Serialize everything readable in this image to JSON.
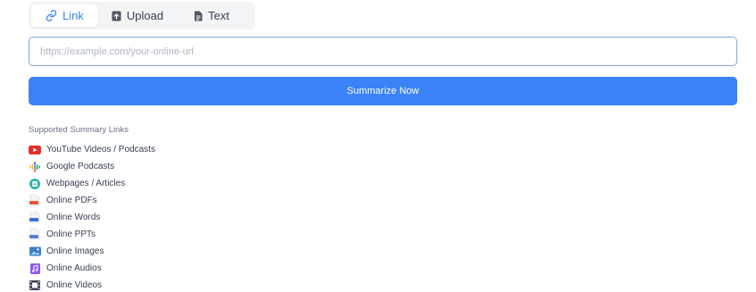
{
  "tabs": [
    {
      "label": "Link",
      "icon": "link-icon",
      "active": true
    },
    {
      "label": "Upload",
      "icon": "upload-icon",
      "active": false
    },
    {
      "label": "Text",
      "icon": "document-icon",
      "active": false
    }
  ],
  "input": {
    "placeholder": "https://example.com/your-online-url",
    "value": ""
  },
  "submit": {
    "label": "Summarize Now"
  },
  "supported": {
    "title": "Supported Summary Links",
    "items": [
      {
        "label": "YouTube Videos / Podcasts",
        "icon": "youtube-icon"
      },
      {
        "label": "Google Podcasts",
        "icon": "google-podcasts-icon"
      },
      {
        "label": "Webpages / Articles",
        "icon": "webpage-icon"
      },
      {
        "label": "Online PDFs",
        "icon": "pdf-icon"
      },
      {
        "label": "Online Words",
        "icon": "word-icon"
      },
      {
        "label": "Online PPTs",
        "icon": "ppt-icon"
      },
      {
        "label": "Online Images",
        "icon": "image-icon"
      },
      {
        "label": "Online Audios",
        "icon": "audio-icon"
      },
      {
        "label": "Online Videos",
        "icon": "video-icon"
      }
    ]
  },
  "colors": {
    "accent": "#3b82f6",
    "youtube": "#e52d27",
    "pdf": "#e8533f",
    "word": "#3b6fd4",
    "ppt": "#5b7fd0",
    "image": "#3b82c4",
    "audio": "#8b5cf6",
    "webpage": "#2fb5a8"
  }
}
